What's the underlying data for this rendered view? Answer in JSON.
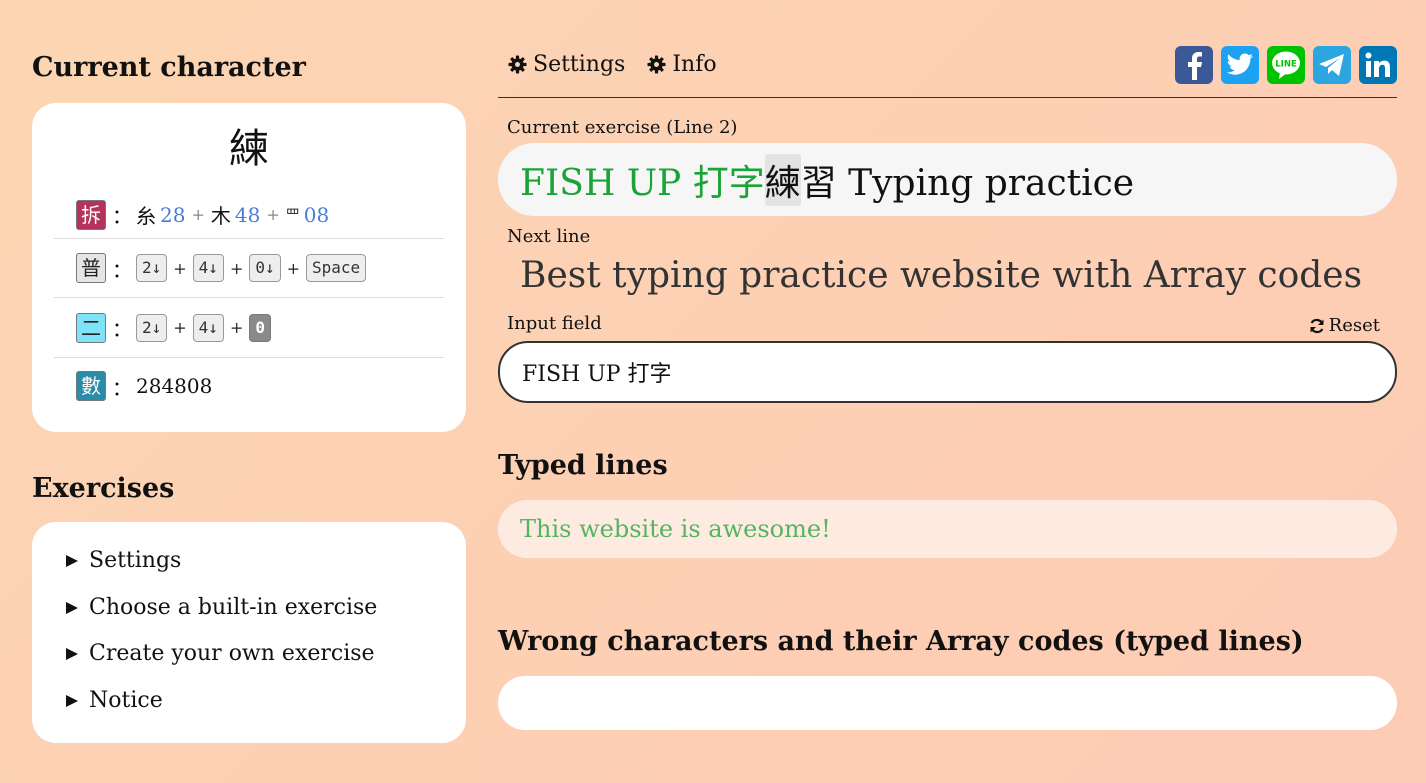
{
  "left": {
    "current_title": "Current character",
    "char": "練",
    "rows": {
      "split": {
        "badge": "拆",
        "p1": "糸",
        "n1": "28",
        "p2": "木",
        "n2": "48",
        "p3": "罒",
        "n3": "08"
      },
      "normal": {
        "badge": "普",
        "k1": "2↓",
        "k2": "4↓",
        "k3": "0↓",
        "k4": "Space"
      },
      "second": {
        "badge": "二",
        "k1": "2↓",
        "k2": "4↓",
        "k3": "0"
      },
      "number": {
        "badge": "數",
        "value": "284808"
      }
    },
    "colon": "：",
    "plus": "+",
    "exercises_title": "Exercises",
    "exercise_items": [
      "Settings",
      "Choose a built-in exercise",
      "Create your own exercise",
      "Notice"
    ]
  },
  "nav": {
    "settings": "Settings",
    "info": "Info"
  },
  "share": {
    "facebook_color": "#3b5998",
    "twitter_color": "#1da1f2",
    "line_color": "#00c300",
    "telegram_color": "#2ca5e0",
    "linkedin_color": "#0077b5"
  },
  "exercise": {
    "label": "Current exercise (Line 2)",
    "typed": "FISH UP 打字",
    "current": "練",
    "rest": "習 Typing practice"
  },
  "next": {
    "label": "Next line",
    "text": "Best typing practice website with Array codes"
  },
  "input": {
    "label": "Input field",
    "reset": "Reset",
    "value": "FISH UP 打字"
  },
  "typed_lines": {
    "title": "Typed lines",
    "lines": [
      "This website is awesome!"
    ]
  },
  "wrong": {
    "title": "Wrong characters and their Array codes (typed lines)"
  }
}
